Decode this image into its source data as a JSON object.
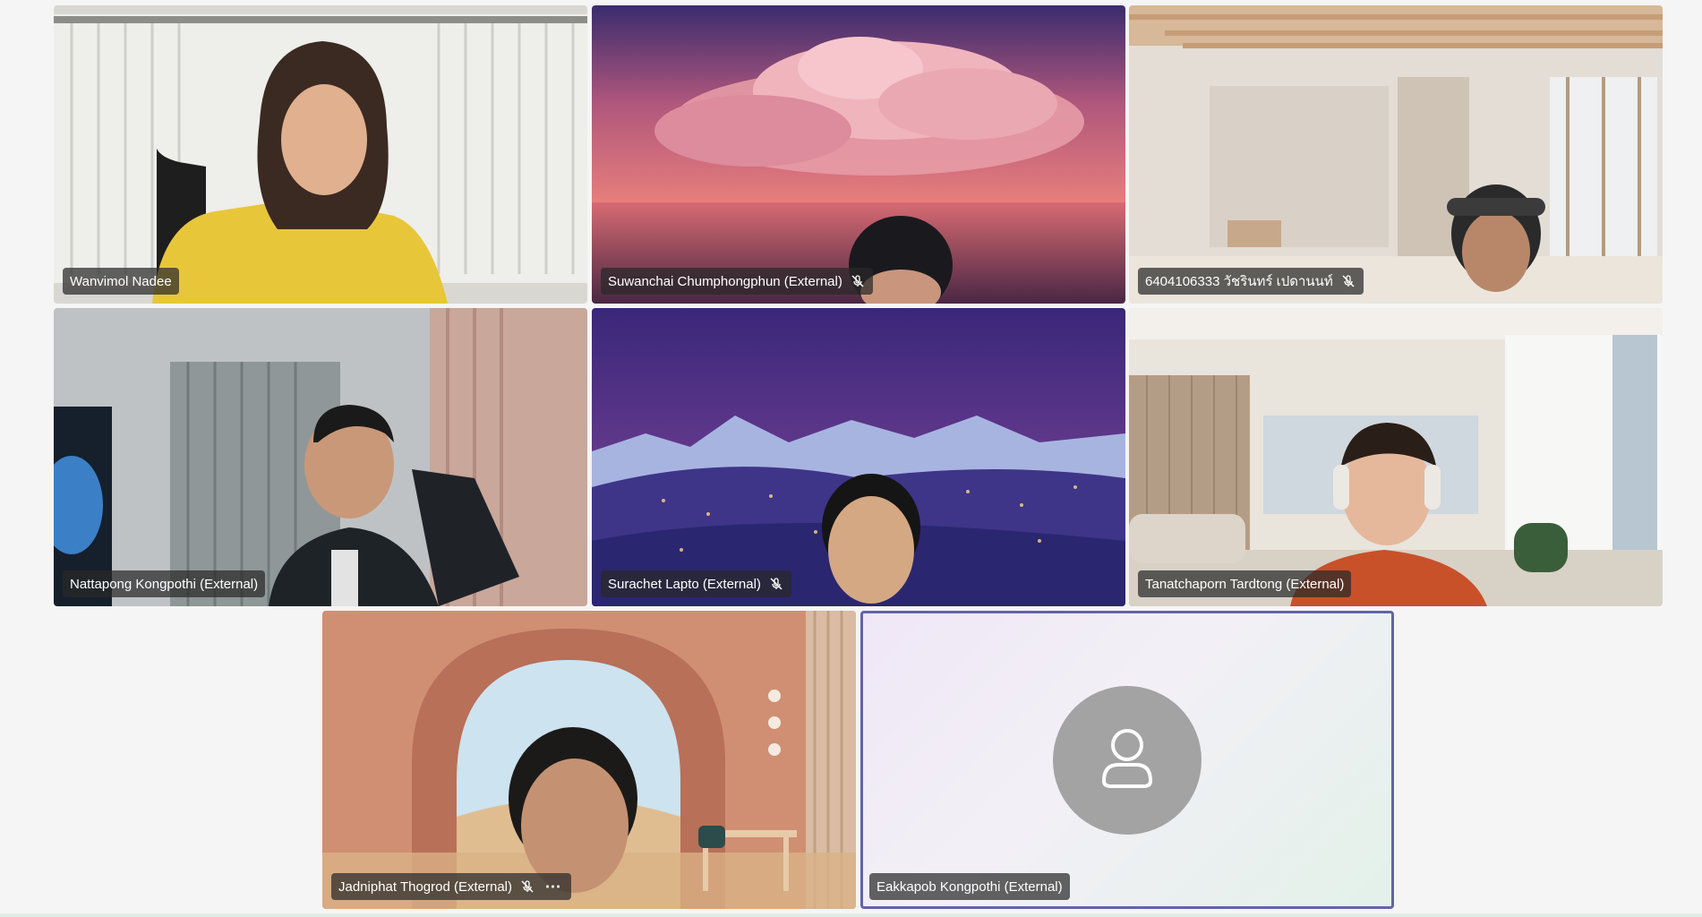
{
  "participants": [
    {
      "name": "Wanvimol Nadee",
      "muted": false,
      "more": false
    },
    {
      "name": "Suwanchai Chumphongphun (External)",
      "muted": true,
      "more": false
    },
    {
      "name": "6404106333 วัชรินทร์ เปดานนท์",
      "muted": true,
      "more": false
    },
    {
      "name": "Nattapong Kongpothi (External)",
      "muted": false,
      "more": false
    },
    {
      "name": "Surachet Lapto (External)",
      "muted": true,
      "more": false
    },
    {
      "name": "Tanatchaporn Tardtong (External)",
      "muted": false,
      "more": false
    },
    {
      "name": "Jadniphat Thogrod (External)",
      "muted": true,
      "more": true
    },
    {
      "name": "Eakkapob Kongpothi (External)",
      "muted": false,
      "more": false,
      "video_off": true,
      "active_speaker": true
    }
  ],
  "colors": {
    "accent": "#6264a7",
    "avatar_bg": "#a3a3a3",
    "nameplate_bg": "rgba(40,40,40,0.72)"
  },
  "icons": {
    "mic_off": "mic-off-icon",
    "more": "more-options-icon",
    "avatar": "person-icon"
  }
}
